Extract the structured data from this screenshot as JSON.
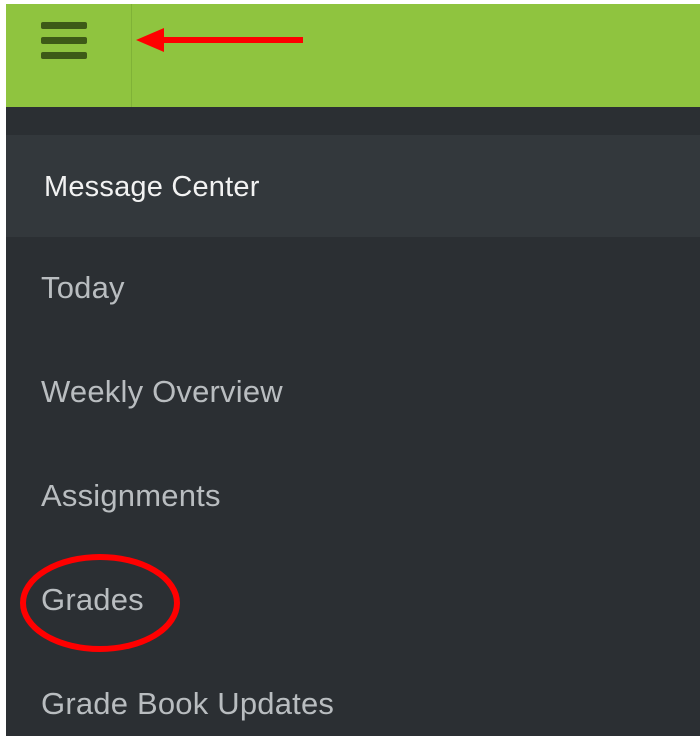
{
  "topbar": {
    "menu_icon": "hamburger-menu-icon",
    "bar_color": "#8fc43f",
    "icon_color": "#3d5a17"
  },
  "annotations": {
    "arrow_color": "#ff0000",
    "circle_color": "#ff0000",
    "highlighted_item": "Grades"
  },
  "drawer": {
    "background_color": "#2b2f33",
    "section_header": "Message Center",
    "items": [
      {
        "label": "Today"
      },
      {
        "label": "Weekly Overview"
      },
      {
        "label": "Assignments"
      },
      {
        "label": "Grades"
      },
      {
        "label": "Grade Book Updates"
      }
    ]
  }
}
